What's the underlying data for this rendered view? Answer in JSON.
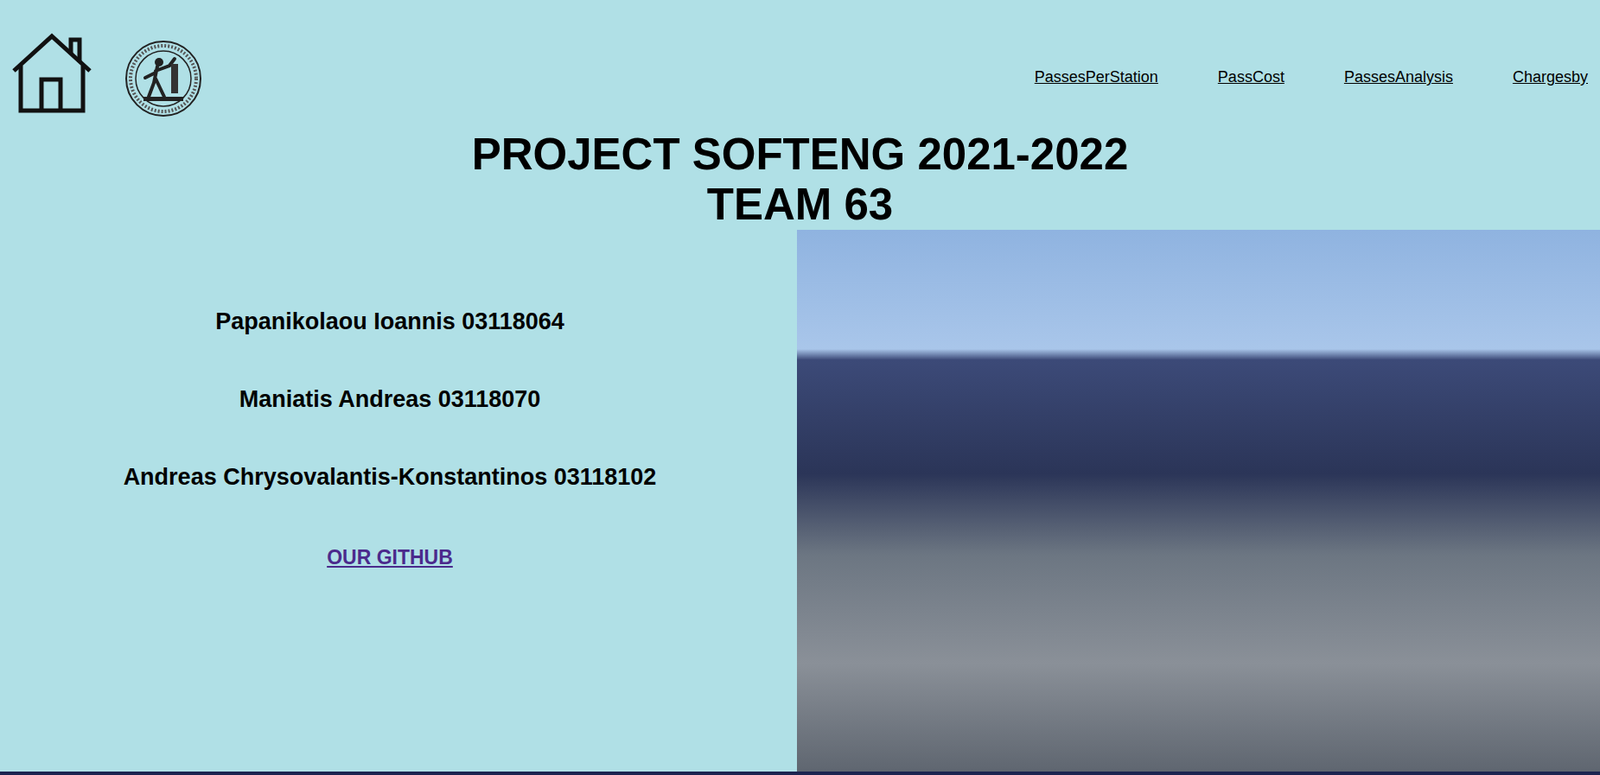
{
  "nav": {
    "links": [
      "PassesPerStation",
      "PassCost",
      "PassesAnalysis",
      "Chargesby"
    ]
  },
  "title": {
    "lines": [
      "PROJECT SOFTENG 2021-2022",
      "TEAM 63"
    ]
  },
  "members": [
    "Papanikolaou Ioannis 03118064",
    "Maniatis Andreas 03118070",
    "Andreas Chrysovalantis-Konstantinos 03118102"
  ],
  "github_link": "OUR GITHUB"
}
